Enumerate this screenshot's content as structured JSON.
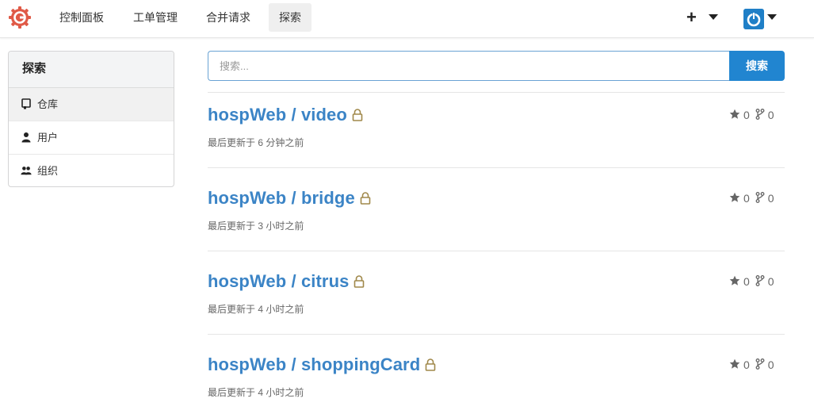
{
  "nav": {
    "items": [
      {
        "label": "控制面板"
      },
      {
        "label": "工单管理"
      },
      {
        "label": "合并请求"
      },
      {
        "label": "探索"
      }
    ],
    "active_index": 3,
    "plus_symbol": "+",
    "accent_color": "#2185d0",
    "logo_color": "#e05a47"
  },
  "sidebar": {
    "header": "探索",
    "items": [
      {
        "label": "仓库",
        "icon": "repo-icon"
      },
      {
        "label": "用户",
        "icon": "person-icon"
      },
      {
        "label": "组织",
        "icon": "organization-icon"
      }
    ]
  },
  "search": {
    "placeholder": "搜索...",
    "value": "",
    "button_label": "搜索"
  },
  "repos": [
    {
      "owner": "hospWeb",
      "separator": "/",
      "name": "video",
      "updated": "最后更新于 6 分钟之前",
      "stars": "0",
      "forks": "0",
      "private": true
    },
    {
      "owner": "hospWeb",
      "separator": "/",
      "name": "bridge",
      "updated": "最后更新于 3 小时之前",
      "stars": "0",
      "forks": "0",
      "private": true
    },
    {
      "owner": "hospWeb",
      "separator": "/",
      "name": "citrus",
      "updated": "最后更新于 4 小时之前",
      "stars": "0",
      "forks": "0",
      "private": true
    },
    {
      "owner": "hospWeb",
      "separator": "/",
      "name": "shoppingCard",
      "updated": "最后更新于 4 小时之前",
      "stars": "0",
      "forks": "0",
      "private": true
    }
  ]
}
